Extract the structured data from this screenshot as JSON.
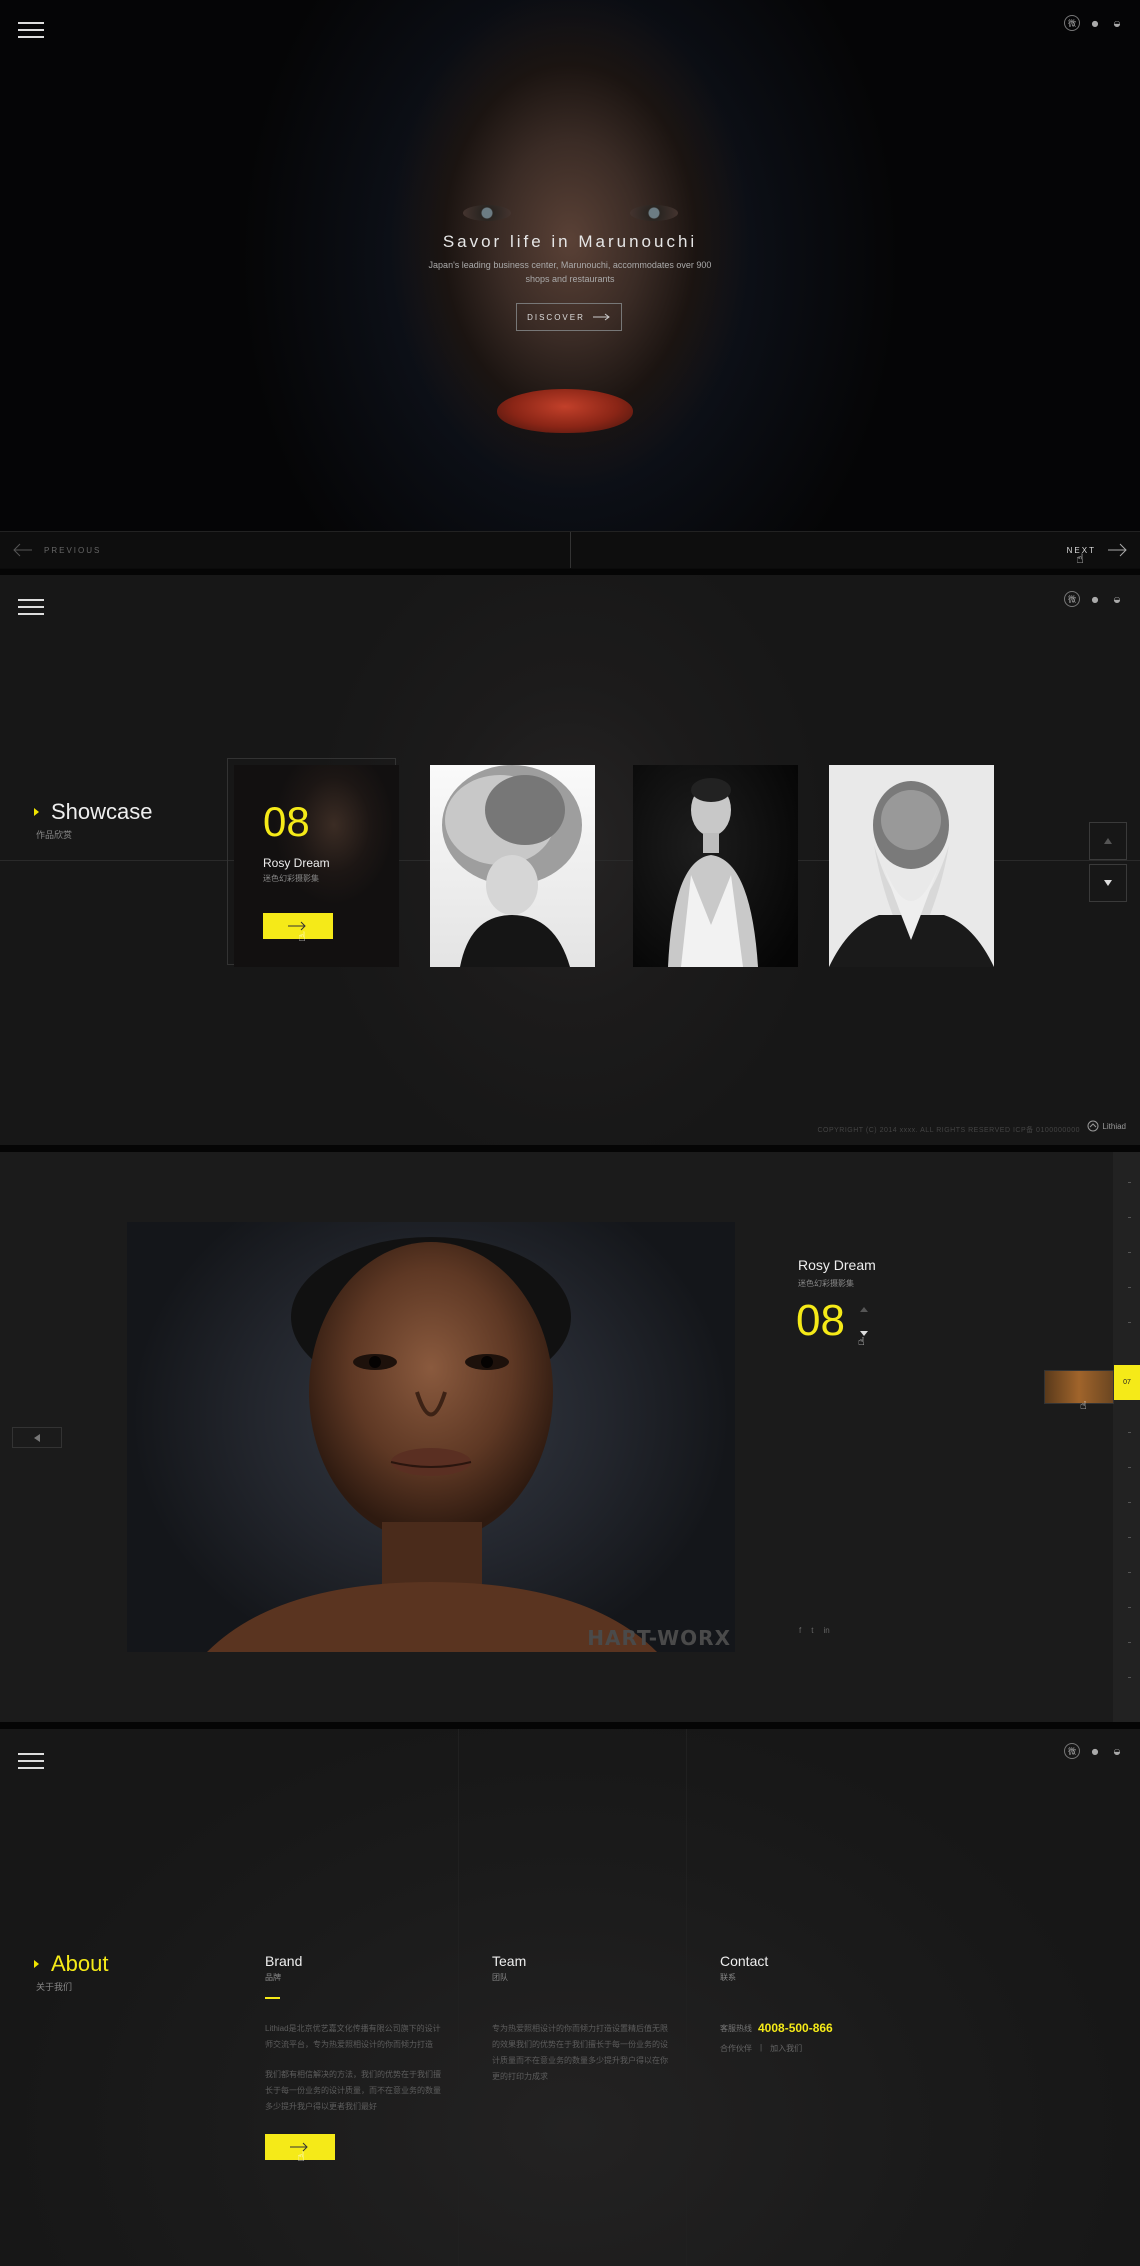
{
  "hero": {
    "title": "Savor life in Marunouchi",
    "subtitle": "Japan's leading business center, Marunouchi, accommodates over 900 shops and restaurants",
    "discover_label": "DISCOVER",
    "prev_label": "PREVIOUS",
    "next_label": "NEXT"
  },
  "social": {
    "icons": [
      "weibo-icon",
      "qq-icon",
      "wechat-icon"
    ]
  },
  "showcase": {
    "title": "Showcase",
    "title_cn": "作品欣赏",
    "active_card": {
      "number": "08",
      "name": "Rosy Dream",
      "name_cn": "迷色幻彩摄影集"
    },
    "footer_copy": "COPYRIGHT (C) 2014 xxxx. ALL RIGHTS RESERVED    ICP备 0100000000",
    "footer_logo": "Lithiad"
  },
  "detail": {
    "name": "Rosy Dream",
    "name_cn": "迷色幻彩摄影集",
    "number": "08",
    "watermark": "HART-WORX",
    "thumb_number": "07",
    "share": [
      "f",
      "t",
      "in"
    ]
  },
  "about": {
    "title": "About",
    "title_cn": "关于我们",
    "brand": {
      "heading": "Brand",
      "heading_cn": "品牌",
      "p1": "Lithiad是北京优艺嘉文化传播有限公司旗下的设计师交流平台，专为热爱照相设计的你而倾力打造",
      "p2": "我们都有相信解决的方法，我们的优势在于我们擅长于每一份业务的设计质量，而不在意业务的数量多少提升我户得以更者我们最好"
    },
    "team": {
      "heading": "Team",
      "heading_cn": "团队",
      "p1": "专为热爱照相设计的你而倾力打造设置精后值无限的效果我们的优势在于我们擅长于每一份业务的设计质量而不在意业务的数量多少提升我户得以在你更的打印力成求"
    },
    "contact": {
      "heading": "Contact",
      "heading_cn": "联系",
      "hotline_label": "客服热线",
      "hotline": "4008-500-866",
      "link1": "合作伙伴",
      "link2": "加入我们"
    }
  }
}
